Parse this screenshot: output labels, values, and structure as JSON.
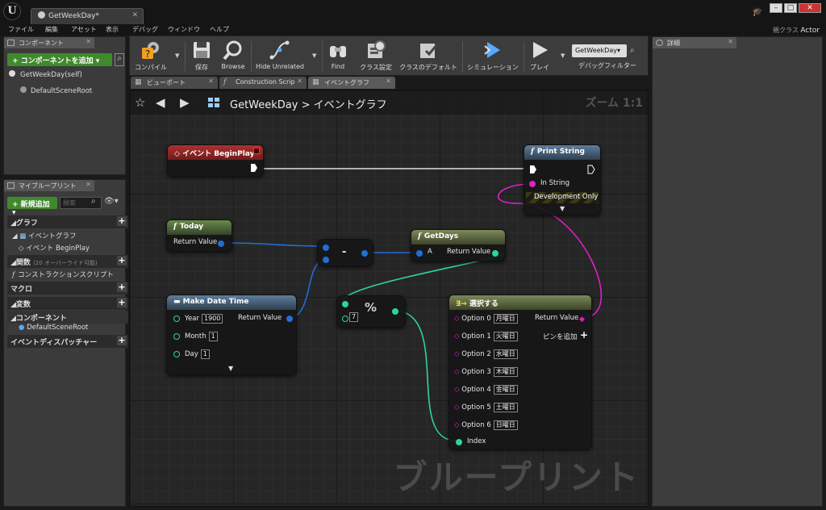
{
  "app": {
    "doc_tab": "GetWeekDay",
    "parent_class_label": "親クラス",
    "parent_class_value": "Actor"
  },
  "menu": [
    "ファイル",
    "編集",
    "アセット",
    "表示",
    "デバッグ",
    "ウィンドウ",
    "ヘルプ"
  ],
  "components": {
    "tab": "コンポーネント",
    "add_button": "+ コンポーネントを追加 ▾",
    "items": [
      "GetWeekDay(self)",
      "DefaultSceneRoot"
    ]
  },
  "my_blueprint": {
    "tab": "マイブループリント",
    "add_button": "+ 新規追加 ▾",
    "search_placeholder": "検索",
    "sections": {
      "graph": "グラフ",
      "graph_item1": "イベントグラフ",
      "graph_item2": "イベント BeginPlay",
      "functions": "関数",
      "functions_sub": "(20 オーバーライド可能)",
      "functions_item": "コンストラクションスクリプト",
      "macros": "マクロ",
      "variables": "変数",
      "components": "コンポーネント",
      "components_item": "DefaultSceneRoot",
      "dispatchers": "イベントディスパッチャー"
    }
  },
  "details": {
    "tab": "詳細"
  },
  "toolbar": {
    "compile": "コンパイル",
    "save": "保存",
    "browse": "Browse",
    "hide_unrelated": "Hide Unrelated",
    "find": "Find",
    "class_settings": "クラス設定",
    "class_defaults": "クラスのデフォルト",
    "simulation": "シミュレーション",
    "play": "プレイ",
    "debug_object": "GetWeekDay▾",
    "debug_filter": "デバッグフィルター"
  },
  "editor_tabs": [
    "ビューポート",
    "Construction Scrip",
    "イベントグラフ"
  ],
  "graph": {
    "breadcrumb_root": "GetWeekDay",
    "breadcrumb_sep": ">",
    "breadcrumb_leaf": "イベントグラフ",
    "zoom": "ズーム 1:1",
    "watermark": "ブループリント"
  },
  "nodes": {
    "begin_play": {
      "title": "イベント BeginPlay"
    },
    "print_string": {
      "title": "Print String",
      "pin_in": "In String",
      "dev_only": "Development Only"
    },
    "today": {
      "title": "Today",
      "out": "Return Value"
    },
    "subtract": {
      "op": "-"
    },
    "get_days": {
      "title": "GetDays",
      "in": "A",
      "out": "Return Value"
    },
    "make_date_time": {
      "title": "Make Date Time",
      "year_label": "Year",
      "year_value": "1900",
      "month_label": "Month",
      "month_value": "1",
      "day_label": "Day",
      "day_value": "1",
      "out": "Return Value"
    },
    "modulo": {
      "op": "%",
      "b_value": "7"
    },
    "select": {
      "title": "選択する",
      "options": [
        {
          "label": "Option 0",
          "value": "月曜日"
        },
        {
          "label": "Option 1",
          "value": "火曜日"
        },
        {
          "label": "Option 2",
          "value": "水曜日"
        },
        {
          "label": "Option 3",
          "value": "木曜日"
        },
        {
          "label": "Option 4",
          "value": "金曜日"
        },
        {
          "label": "Option 5",
          "value": "土曜日"
        },
        {
          "label": "Option 6",
          "value": "日曜日"
        }
      ],
      "out": "Return Value",
      "add_pin": "ピンを追加",
      "index": "Index"
    }
  },
  "colors": {
    "accent_green": "#3f8a2c",
    "exec_wire": "#ffffff",
    "struct_wire": "#1f6fd6",
    "int_wire": "#2fd3a0",
    "string_wire": "#e020c8"
  }
}
